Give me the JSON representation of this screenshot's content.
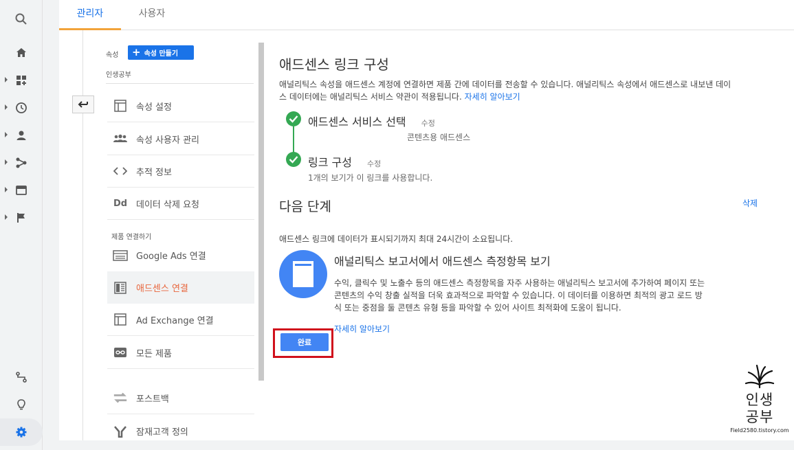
{
  "tabs": [
    "관리자",
    "사용자"
  ],
  "property": {
    "label": "속성",
    "create_label": "속성 만들기",
    "name": "인생공부"
  },
  "menu": {
    "items": [
      {
        "label": "속성 설정",
        "icon": "window-icon"
      },
      {
        "label": "속성 사용자 관리",
        "icon": "people-icon"
      },
      {
        "label": "추적 정보",
        "icon": "code-icon"
      },
      {
        "label": "데이터 삭제 요청",
        "icon": "dd-icon"
      }
    ],
    "section_title": "제품 연결하기",
    "link_items": [
      {
        "label": "Google Ads 연결",
        "icon": "ads-icon"
      },
      {
        "label": "애드센스 연결",
        "icon": "adsense-icon",
        "selected": true
      },
      {
        "label": "Ad Exchange 연결",
        "icon": "window-icon"
      },
      {
        "label": "모든 제품",
        "icon": "link-icon"
      },
      {
        "label": "포스트백",
        "icon": "postback-icon"
      },
      {
        "label": "잠재고객 정의",
        "icon": "audience-icon"
      }
    ]
  },
  "content": {
    "title": "애드센스 링크 구성",
    "desc_line1": "애널리틱스 속성을 애드센스 계정에 연결하면 제품 간에 데이터를 전송할 수 있습니다. 애널리틱스 속성에서 애드센스로 내보낸 데이",
    "desc_line2": "스 데이터에는 애널리틱스 서비스 약관이 적용됩니다.",
    "desc_link": "자세히 알아보기",
    "step1": {
      "title": "애드센스 서비스 선택",
      "edit": "수정",
      "sub": "콘텐츠용 애드센스"
    },
    "step2": {
      "title": "링크 구성",
      "edit": "수정",
      "sub": "1개의 보기가 이 링크를 사용합니다."
    },
    "next_title": "다음 단계",
    "delete_label": "삭제",
    "note": "애드센스 링크에 데이터가 표시되기까지 최대 24시간이 소요됩니다.",
    "card_title": "애널리틱스 보고서에서 애드센스 측정항목 보기",
    "card_line1": "수익, 클릭수 및 노출수 등의 애드센스 측정항목을 자주 사용하는 애널리틱스 보고서에 추가하여 페이지 또는",
    "card_line2": "콘텐츠의 수익 창출 실적을 더욱 효과적으로 파악할 수 있습니다. 이 데이터를 이용하면 최적의 광고 로드 방",
    "card_line3": "식 또는 중점을 둘 콘텐츠 유형 등을 파악할 수 있어 사이트 최적화에 도움이 됩니다.",
    "card_link": "자세히 알아보기",
    "done_label": "완료"
  },
  "watermark": {
    "line1": "인생",
    "line2": "공부",
    "url": "Field2580.tistory.com"
  },
  "colors": {
    "accent": "#1a73e8",
    "selected": "#e8663d",
    "check": "#34a853",
    "highlight": "#d0101c"
  }
}
